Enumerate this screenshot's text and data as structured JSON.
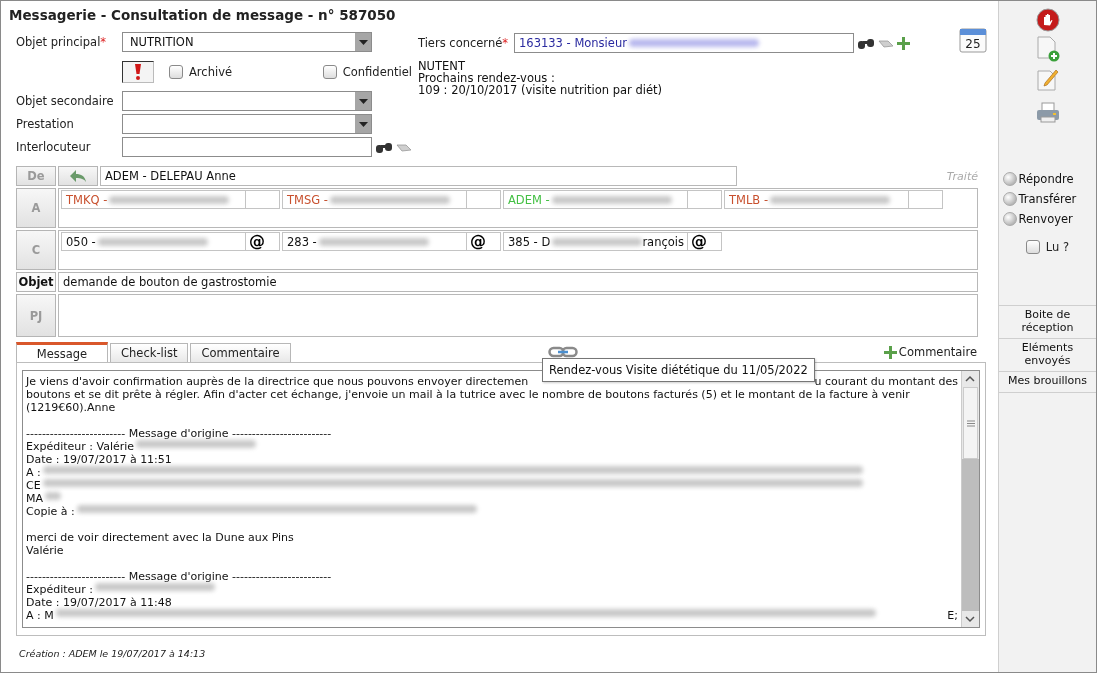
{
  "title": "Messagerie - Consultation de message - n° 587050",
  "form": {
    "main_object": {
      "label": "Objet principal",
      "required_mark": "*",
      "value": "NUTRITION"
    },
    "checkboxes": [
      {
        "label": "Archivé",
        "checked": false
      },
      {
        "label": "Confidentiel",
        "checked": false
      }
    ],
    "secondary_object": {
      "label": "Objet secondaire"
    },
    "service": {
      "label": "Prestation"
    },
    "contact": {
      "label": "Interlocuteur"
    }
  },
  "third_party": {
    "label": "Tiers concerné",
    "required_mark": "*",
    "value": "163133 - Monsieur",
    "redacted": true
  },
  "info_lines": [
    "NUTENT",
    "Prochains rendez-vous :",
    "109 : 20/10/2017 (visite nutrition par diét)"
  ],
  "calendar_day": "25",
  "sender": {
    "label": "De",
    "value": "ADEM - DELEPAU Anne",
    "status": "Traité"
  },
  "to": {
    "label": "A",
    "recipients": [
      {
        "text": "TMKQ - ",
        "color": "#c8502e"
      },
      {
        "text": "TMSG - ",
        "color": "#c8502e"
      },
      {
        "text": "ADEM - ",
        "color": "#44c044"
      },
      {
        "text": "TMLB - ",
        "color": "#c8502e"
      }
    ]
  },
  "cc": {
    "label": "C",
    "recipients": [
      {
        "text": "050 - ",
        "mail": "@"
      },
      {
        "text": "283 - ",
        "mail": "@"
      },
      {
        "text": "385 - D",
        "after": "rançois",
        "mail": "@"
      }
    ]
  },
  "subject": {
    "label": "Objet",
    "value": "demande de bouton de gastrostomie"
  },
  "attachments": {
    "label": "PJ"
  },
  "tabs": [
    {
      "label": "Message",
      "selected": true
    },
    {
      "label": "Check-list",
      "selected": false
    },
    {
      "label": "Commentaire",
      "selected": false
    }
  ],
  "comment_button": "Commentaire",
  "tooltip": "Rendez-vous Visite diététique du 11/05/2022",
  "body": [
    {
      "kind": "plain",
      "text": "Je viens d'avoir confirmation auprès de la directrice que nous pouvons envoyer directemen",
      "after": "u courant du montant des"
    },
    {
      "kind": "plain",
      "text": "boutons et se dit prête à régler. Afin d'acter cet échange, j'envoie un mail à la tutrice avec le nombre de boutons facturés (5) et le montant de la facture à venir"
    },
    {
      "kind": "plain",
      "text": "(1219€60).Anne"
    },
    {
      "kind": "blank"
    },
    {
      "kind": "plain",
      "text": "------------------------- Message d'origine -------------------------"
    },
    {
      "kind": "redacted_short",
      "text": "Expéditeur : Valérie"
    },
    {
      "kind": "plain",
      "text": "Date : 19/07/2017 à 11:51"
    },
    {
      "kind": "redacted_long",
      "text": "A : "
    },
    {
      "kind": "redacted_long",
      "text": "CE"
    },
    {
      "kind": "redacted_tiny",
      "text": "MA"
    },
    {
      "kind": "redacted_medium",
      "text": "Copie à : "
    },
    {
      "kind": "blank"
    },
    {
      "kind": "plain",
      "text": "merci de voir directement avec la Dune aux Pins"
    },
    {
      "kind": "plain",
      "text": "Valérie"
    },
    {
      "kind": "blank"
    },
    {
      "kind": "plain",
      "text": "------------------------- Message d'origine -------------------------"
    },
    {
      "kind": "redacted_short",
      "text": "Expéditeur : "
    },
    {
      "kind": "plain",
      "text": "Date : 19/07/2017 à 11:48"
    },
    {
      "kind": "redacted_long",
      "text": "A : M",
      "after": "E;"
    }
  ],
  "footer": "Création : ADEM le 19/07/2017 à 14:13",
  "actions": [
    {
      "label": "Répondre"
    },
    {
      "label": "Transférer"
    },
    {
      "label": "Renvoyer"
    }
  ],
  "read_checkbox": {
    "label": "Lu ?",
    "checked": false
  },
  "folders": [
    "Boite de réception",
    "Eléments envoyés",
    "Mes brouillons"
  ]
}
